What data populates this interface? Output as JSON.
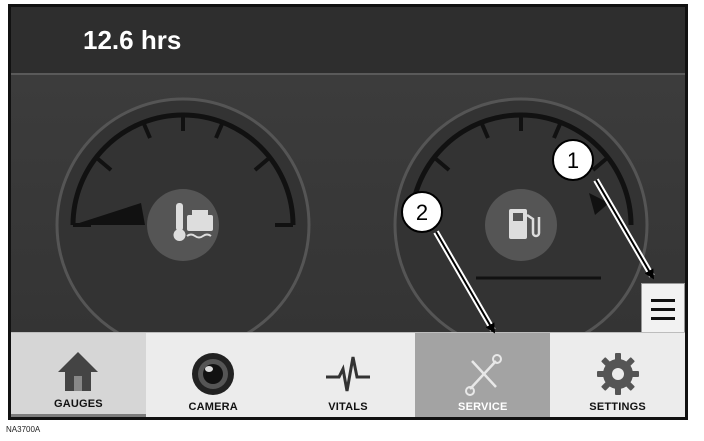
{
  "header": {
    "hours": "12.6 hrs"
  },
  "gauges": [
    {
      "icon": "engine-coolant-temperature-icon"
    },
    {
      "icon": "fuel-pump-icon"
    }
  ],
  "menu_button": {
    "icon": "hamburger-menu-icon"
  },
  "nav": {
    "items": [
      {
        "label": "GAUGES",
        "icon": "house-icon",
        "state": "selected"
      },
      {
        "label": "CAMERA",
        "icon": "camera-lens-icon",
        "state": "normal"
      },
      {
        "label": "VITALS",
        "icon": "waveform-icon",
        "state": "normal"
      },
      {
        "label": "SERVICE",
        "icon": "wrench-screwdriver-icon",
        "state": "highlighted"
      },
      {
        "label": "SETTINGS",
        "icon": "gear-icon",
        "state": "normal"
      }
    ]
  },
  "callouts": {
    "one": "1",
    "two": "2"
  },
  "caption": "NA3700A",
  "colors": {
    "screen": "#3a3a3a",
    "header": "#2e2e2e",
    "service_highlight": "#a3a3a3",
    "navbar": "#ececec"
  }
}
